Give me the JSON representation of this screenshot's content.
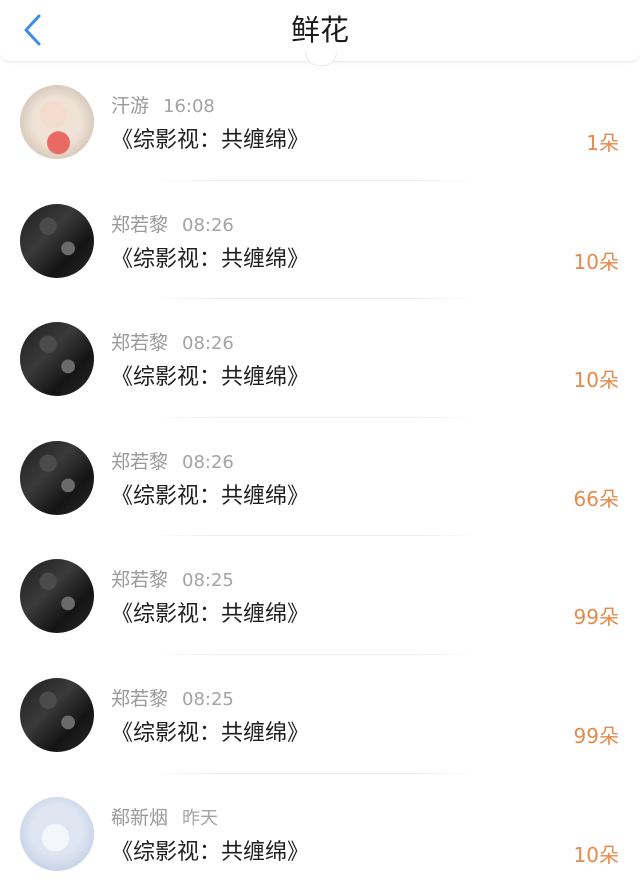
{
  "header": {
    "title": "鲜花",
    "back_icon": "chevron-left-icon",
    "accent_color": "#3b8cf0"
  },
  "colors": {
    "count": "#e38a4c",
    "meta": "#9a9a9a",
    "text": "#1e1e1e"
  },
  "list": {
    "items": [
      {
        "user": "汗游",
        "time": "16:08",
        "book": "《综影视：共缠绵》",
        "count": "1朵",
        "avatar": "light"
      },
      {
        "user": "郑若黎",
        "time": "08:26",
        "book": "《综影视：共缠绵》",
        "count": "10朵",
        "avatar": "dark"
      },
      {
        "user": "郑若黎",
        "time": "08:26",
        "book": "《综影视：共缠绵》",
        "count": "10朵",
        "avatar": "dark"
      },
      {
        "user": "郑若黎",
        "time": "08:26",
        "book": "《综影视：共缠绵》",
        "count": "66朵",
        "avatar": "dark"
      },
      {
        "user": "郑若黎",
        "time": "08:25",
        "book": "《综影视：共缠绵》",
        "count": "99朵",
        "avatar": "dark"
      },
      {
        "user": "郑若黎",
        "time": "08:25",
        "book": "《综影视：共缠绵》",
        "count": "99朵",
        "avatar": "dark"
      },
      {
        "user": "郗新烟",
        "time": "昨天",
        "book": "《综影视：共缠绵》",
        "count": "10朵",
        "avatar": "anime"
      }
    ]
  }
}
